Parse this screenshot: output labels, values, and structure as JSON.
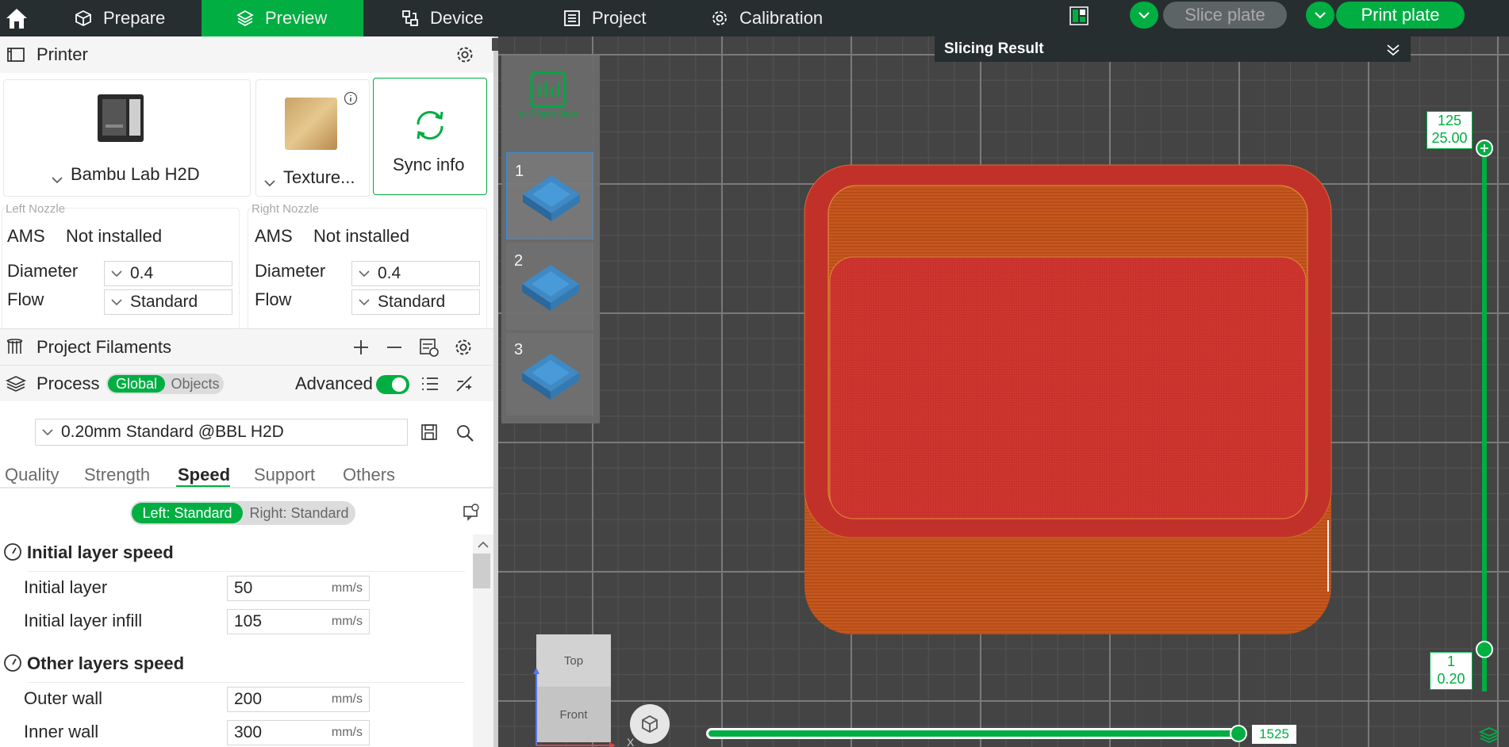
{
  "topbar": {
    "tabs": [
      {
        "label": "Prepare"
      },
      {
        "label": "Preview"
      },
      {
        "label": "Device"
      },
      {
        "label": "Project"
      },
      {
        "label": "Calibration"
      }
    ],
    "slice_label": "Slice plate",
    "print_label": "Print plate"
  },
  "printer": {
    "title": "Printer",
    "name": "Bambu Lab H2D",
    "plate": "Texture...",
    "sync_label": "Sync info",
    "left_nozzle": {
      "title": "Left Nozzle",
      "ams_label": "AMS",
      "ams_value": "Not installed",
      "diameter_label": "Diameter",
      "diameter": "0.4",
      "flow_label": "Flow",
      "flow": "Standard"
    },
    "right_nozzle": {
      "title": "Right Nozzle",
      "ams_label": "AMS",
      "ams_value": "Not installed",
      "diameter_label": "Diameter",
      "diameter": "0.4",
      "flow_label": "Flow",
      "flow": "Standard"
    }
  },
  "filaments": {
    "title": "Project Filaments"
  },
  "process": {
    "title": "Process",
    "toggle_global": "Global",
    "toggle_objects": "Objects",
    "advanced_label": "Advanced",
    "preset": "0.20mm Standard @BBL H2D",
    "tabs": [
      "Quality",
      "Strength",
      "Speed",
      "Support",
      "Others"
    ],
    "nozzle_left": "Left: Standard",
    "nozzle_right": "Right: Standard",
    "groups": [
      {
        "title": "Initial layer speed",
        "rows": [
          {
            "label": "Initial layer",
            "value": "50",
            "unit": "mm/s"
          },
          {
            "label": "Initial layer infill",
            "value": "105",
            "unit": "mm/s"
          }
        ]
      },
      {
        "title": "Other layers speed",
        "rows": [
          {
            "label": "Outer wall",
            "value": "200",
            "unit": "mm/s"
          },
          {
            "label": "Inner wall",
            "value": "300",
            "unit": "mm/s"
          }
        ]
      }
    ]
  },
  "viewport": {
    "slicing_result": "Slicing Result",
    "plates_stats": "All Plates Stats",
    "plates": [
      "1",
      "2",
      "3"
    ],
    "layer_top": {
      "layer": "125",
      "height": "25.00"
    },
    "layer_bottom": {
      "layer": "1",
      "height": "0.20"
    },
    "move_value": "1525",
    "view_top": "Top",
    "view_front": "Front",
    "axis_x": "X"
  },
  "colors": {
    "accent": "#00ae42",
    "topbar": "#262e30",
    "model": "#c8312b",
    "model_side": "#c25a1e"
  }
}
